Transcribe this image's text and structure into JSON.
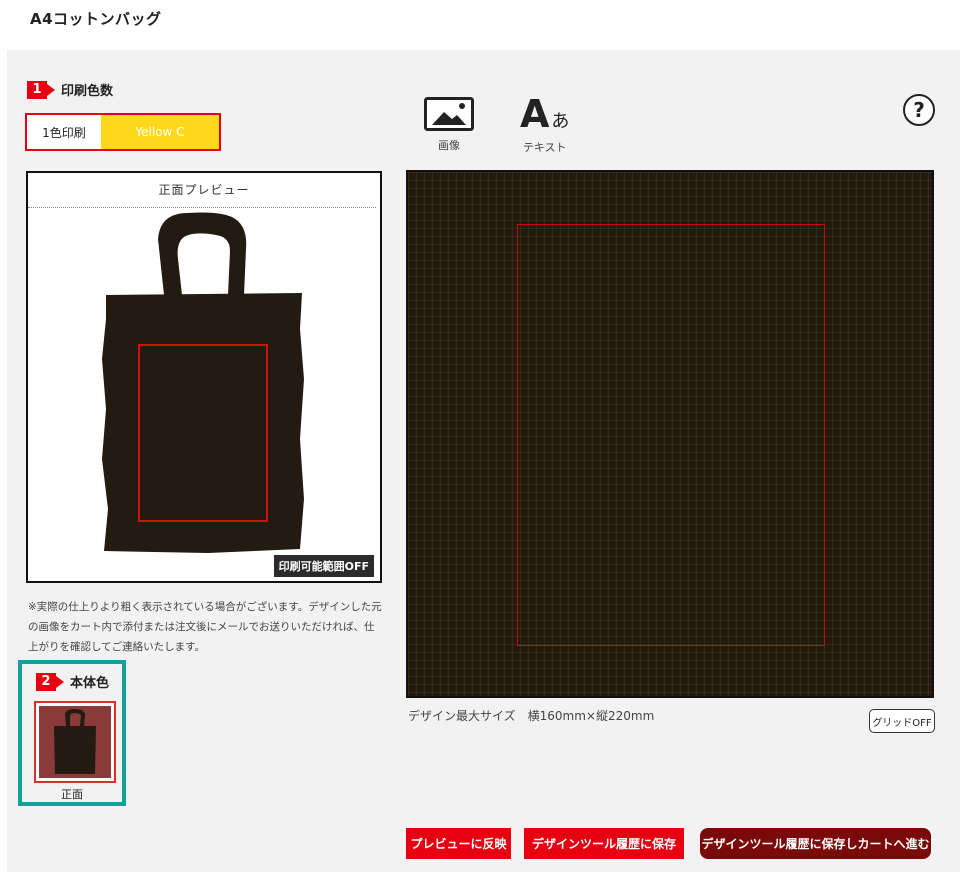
{
  "page": {
    "title": "A4コットンバッグ"
  },
  "step1": {
    "number": "1",
    "label": "印刷色数"
  },
  "color_select": {
    "count": "1色印刷",
    "color": "Yellow C"
  },
  "preview": {
    "title": "正面プレビュー",
    "print_area_toggle": "印刷可能範囲OFF"
  },
  "note": "※実際の仕上りより粗く表示されている場合がございます。デザインした元の画像をカート内で添付または注文後にメールでお送りいただければ、仕上がりを確認してご連絡いたします。",
  "step2": {
    "number": "2",
    "label": "本体色"
  },
  "body_color": {
    "caption": "正面"
  },
  "tools": {
    "image_label": "画像",
    "text_label": "テキスト",
    "text_glyph": "A",
    "text_glyph_kana": "あ",
    "help": "?"
  },
  "canvas": {
    "max_size": "デザイン最大サイズ　横160mm×縦220mm",
    "grid_toggle": "グリッドOFF"
  },
  "buttons": {
    "reflect": "プレビューに反映",
    "save": "デザインツール履歴に保存",
    "save_cart": "デザインツール履歴に保存しカートへ進む"
  },
  "colors": {
    "accent": "#e60012",
    "yellow": "#ffd81c",
    "teal": "#14a19a",
    "bag": "#231a12"
  }
}
